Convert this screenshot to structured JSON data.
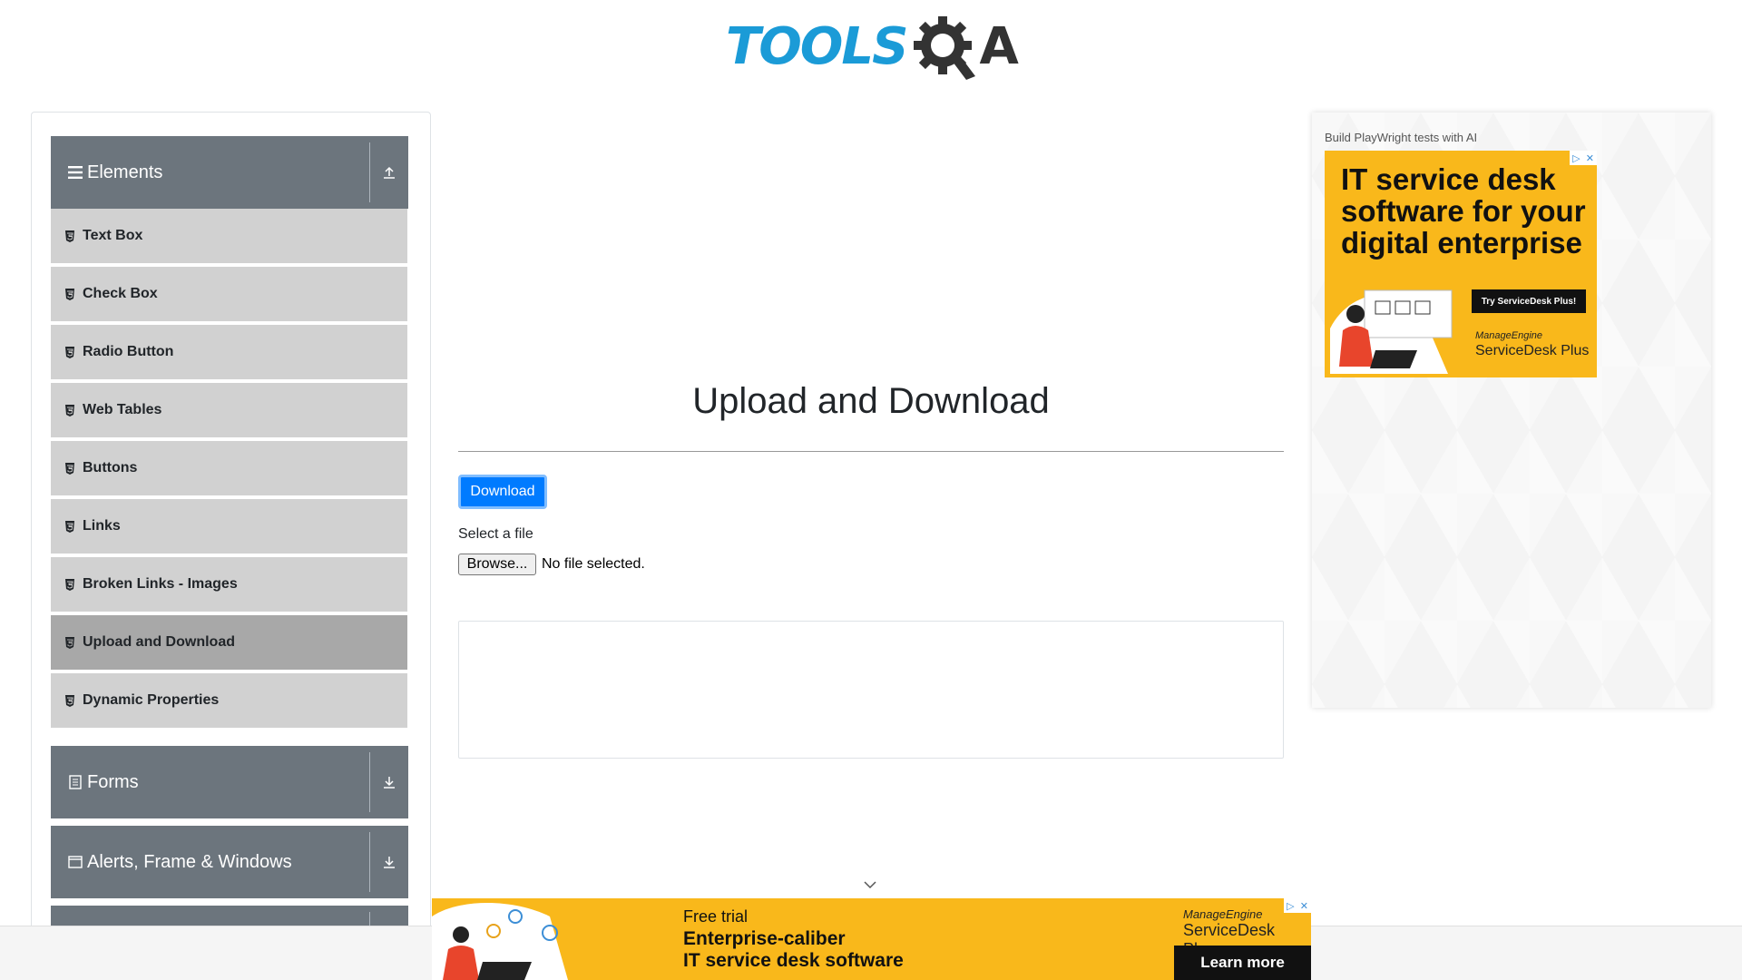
{
  "header": {
    "logo_left": "TOOLS",
    "logo_right": "A"
  },
  "sidebar": {
    "elements_group": {
      "label": "Elements"
    },
    "items": [
      {
        "label": "Text Box"
      },
      {
        "label": "Check Box"
      },
      {
        "label": "Radio Button"
      },
      {
        "label": "Web Tables"
      },
      {
        "label": "Buttons"
      },
      {
        "label": "Links"
      },
      {
        "label": "Broken Links - Images"
      },
      {
        "label": "Upload and Download"
      },
      {
        "label": "Dynamic Properties"
      }
    ],
    "forms_group": {
      "label": "Forms"
    },
    "alerts_group": {
      "label": "Alerts, Frame & Windows"
    }
  },
  "main": {
    "title": "Upload and Download",
    "download_button": "Download",
    "select_label": "Select a file",
    "browse_button": "Browse...",
    "file_status": "No file selected."
  },
  "ad_right": {
    "caption": "Build PlayWright tests with AI",
    "headline": "IT service desk software for your digital enterprise",
    "cta": "Try ServiceDesk Plus!",
    "brand_small": "ManageEngine",
    "brand_large": "ServiceDesk Plus"
  },
  "ad_bottom": {
    "free_trial": "Free trial",
    "line1": "Enterprise-caliber",
    "line2": "IT service desk software",
    "brand_small": "ManageEngine",
    "brand_large": "ServiceDesk Plus",
    "cta": "Learn more"
  },
  "colors": {
    "sidebar_header": "#6c757d",
    "menu_item": "#d1d1d1",
    "menu_active": "#a8a8a8",
    "primary": "#007bff",
    "ad_yellow": "#f9b81b",
    "logo_blue": "#1b9bd7"
  }
}
